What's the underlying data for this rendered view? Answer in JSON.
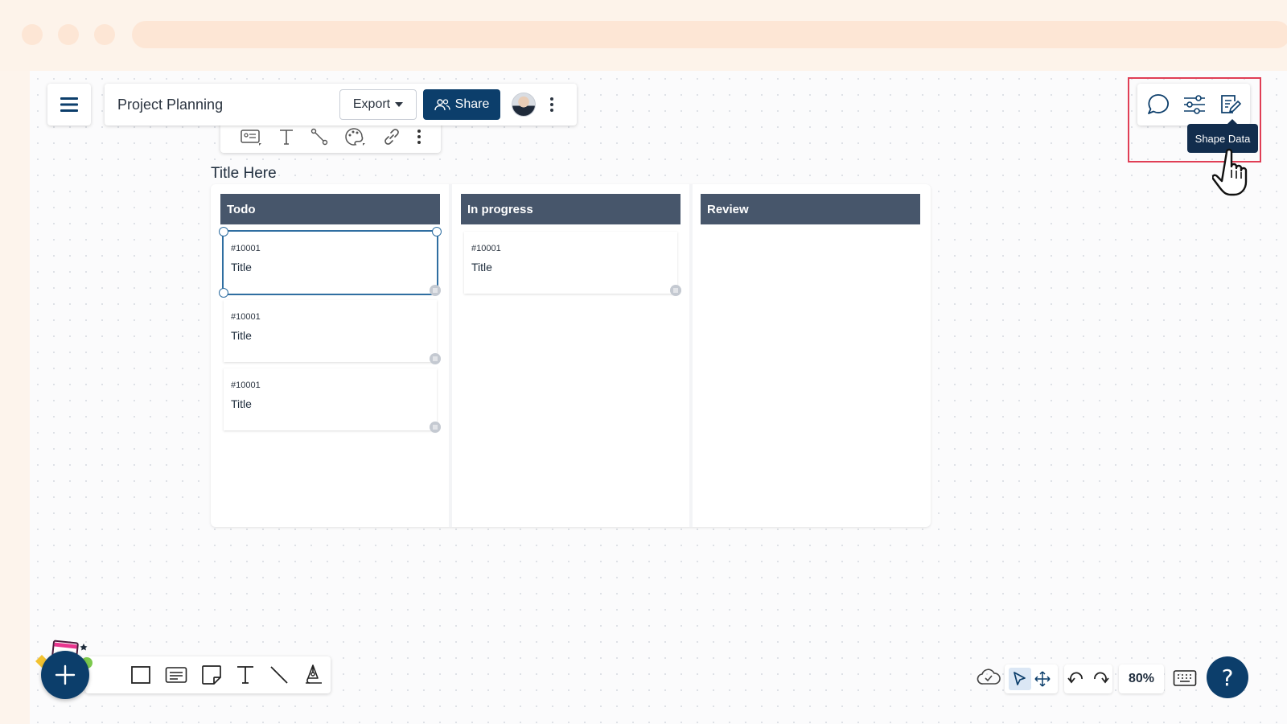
{
  "document": {
    "title": "Project Planning"
  },
  "topbar": {
    "export_label": "Export",
    "share_label": "Share"
  },
  "board": {
    "title": "Title Here",
    "columns": [
      {
        "name": "Todo",
        "cards": [
          {
            "id": "#10001",
            "title": "Title"
          },
          {
            "id": "#10001",
            "title": "Title"
          },
          {
            "id": "#10001",
            "title": "Title"
          }
        ]
      },
      {
        "name": "In progress",
        "cards": [
          {
            "id": "#10001",
            "title": "Title"
          }
        ]
      },
      {
        "name": "Review",
        "cards": []
      }
    ]
  },
  "right_toolbar": {
    "tooltip": "Shape Data",
    "icons": [
      "comment-icon",
      "sliders-icon",
      "shape-data-icon"
    ]
  },
  "bottom_right": {
    "zoom": "80%",
    "help_label": "?"
  },
  "colors": {
    "primary": "#0c3e6b",
    "column_header": "#47566b",
    "highlight": "#e03e55",
    "selection": "#2f6ea1"
  }
}
